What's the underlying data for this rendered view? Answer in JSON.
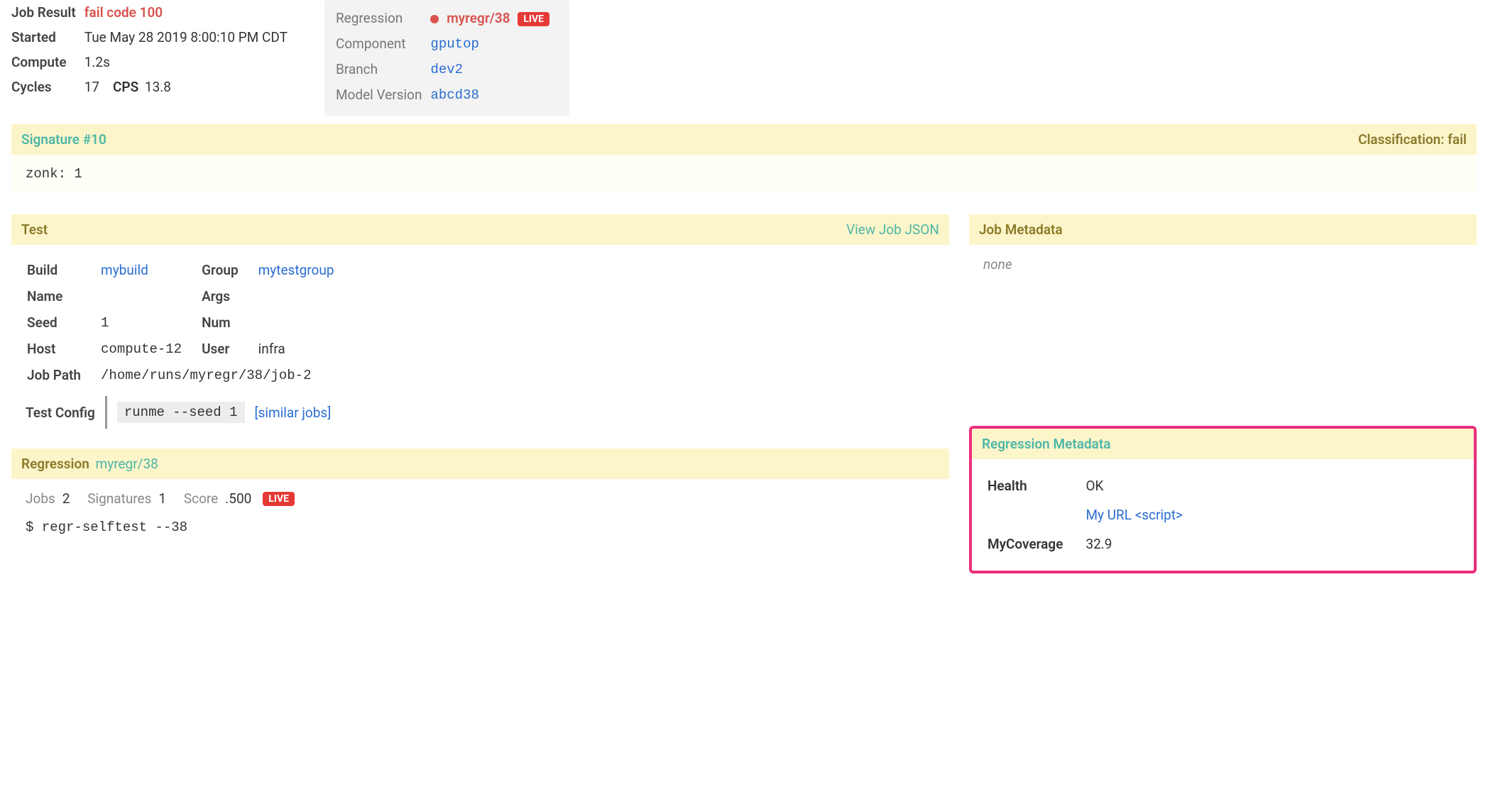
{
  "top": {
    "job_result_label": "Job Result",
    "job_result_value": "fail code 100",
    "started_label": "Started",
    "started_value": "Tue May 28 2019 8:00:10 PM CDT",
    "compute_label": "Compute",
    "compute_value": "1.2s",
    "cycles_label": "Cycles",
    "cycles_value": "17",
    "cps_label": "CPS",
    "cps_value": "13.8"
  },
  "info": {
    "regression_label": "Regression",
    "regression_value": "myregr/38",
    "live_badge": "LIVE",
    "component_label": "Component",
    "component_value": "gputop",
    "branch_label": "Branch",
    "branch_value": "dev2",
    "model_version_label": "Model Version",
    "model_version_value": "abcd38"
  },
  "signature": {
    "title": "Signature #10",
    "classification_label": "Classification: fail",
    "body": "zonk: 1"
  },
  "test": {
    "header": "Test",
    "view_json": "View Job JSON",
    "build_label": "Build",
    "build_value": "mybuild",
    "group_label": "Group",
    "group_value": "mytestgroup",
    "name_label": "Name",
    "args_label": "Args",
    "seed_label": "Seed",
    "seed_value": "1",
    "num_label": "Num",
    "host_label": "Host",
    "host_value": "compute-12",
    "user_label": "User",
    "user_value": "infra",
    "jobpath_label": "Job Path",
    "jobpath_value": "/home/runs/myregr/38/job-2",
    "config_label": "Test Config",
    "config_cmd": "runme --seed 1",
    "similar_jobs": "[similar jobs]"
  },
  "job_meta": {
    "header": "Job Metadata",
    "none": "none"
  },
  "regression": {
    "header_label": "Regression",
    "header_link": "myregr/38",
    "jobs_label": "Jobs",
    "jobs_value": "2",
    "sigs_label": "Signatures",
    "sigs_value": "1",
    "score_label": "Score",
    "score_value": ".500",
    "live_badge": "LIVE",
    "cmd": "$ regr-selftest --38"
  },
  "regr_meta": {
    "header": "Regression Metadata",
    "health_label": "Health",
    "health_value": "OK",
    "url_text": "My URL <script>",
    "coverage_label": "MyCoverage",
    "coverage_value": "32.9"
  }
}
